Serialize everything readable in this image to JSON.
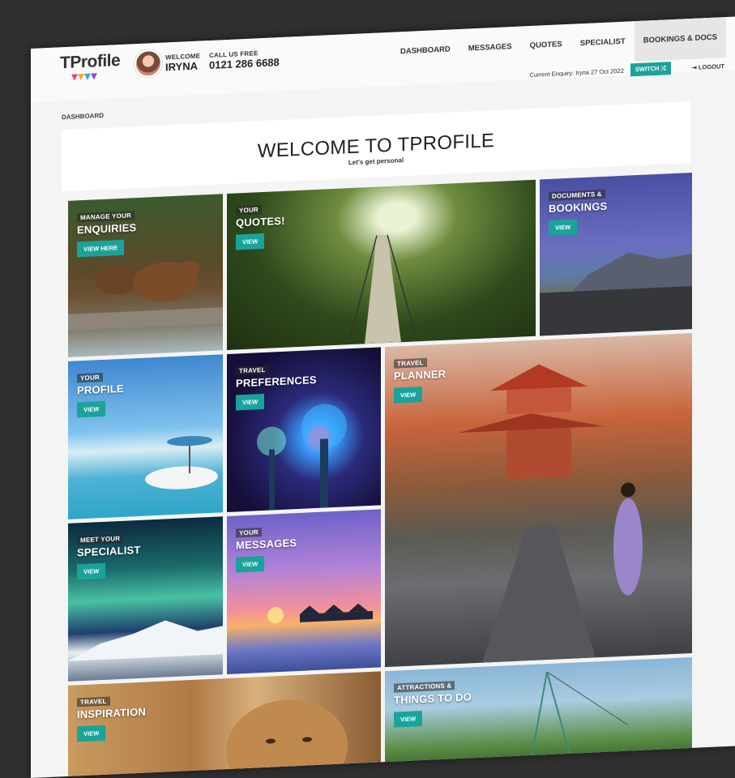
{
  "header": {
    "logo_text": "TProfile",
    "welcome_label": "WELCOME",
    "user_name": "IRYNA",
    "call_label": "CALL US FREE",
    "phone": "0121 286 6688"
  },
  "nav": [
    {
      "label": "DASHBOARD"
    },
    {
      "label": "MESSAGES"
    },
    {
      "label": "QUOTES"
    },
    {
      "label": "SPECIALIST"
    },
    {
      "label": "BOOKINGS & DOCS"
    }
  ],
  "subbar": {
    "enquiry_text": "Current Enquiry: Iryna 27 Oct 2022",
    "switch_label": "SWITCH ⤭",
    "logout_label": "⇥ LOGOUT"
  },
  "breadcrumb": "DASHBOARD",
  "hero": {
    "title": "WELCOME TO TPROFILE",
    "subtitle": "Let's get personal"
  },
  "tiles": {
    "enquiries": {
      "tag": "MANAGE YOUR",
      "title": "ENQUIRIES",
      "button": "VIEW HERE"
    },
    "quotes": {
      "tag": "YOUR",
      "title": "QUOTES!",
      "button": "VIEW"
    },
    "documents": {
      "tag": "DOCUMENTS &",
      "title": "BOOKINGS",
      "button": "VIEW"
    },
    "profile": {
      "tag": "YOUR",
      "title": "PROFILE",
      "button": "VIEW"
    },
    "preferences": {
      "tag": "TRAVEL",
      "title": "PREFERENCES",
      "button": "VIEW"
    },
    "planner": {
      "tag": "TRAVEL",
      "title": "PLANNER",
      "button": "VIEW"
    },
    "specialist": {
      "tag": "MEET YOUR",
      "title": "SPECIALIST",
      "button": "VIEW"
    },
    "messages": {
      "tag": "YOUR",
      "title": "MESSAGES",
      "button": "VIEW"
    },
    "inspiration": {
      "tag": "TRAVEL",
      "title": "INSPIRATION",
      "button": "VIEW"
    },
    "attractions": {
      "tag": "ATTRACTIONS &",
      "title": "THINGS TO DO",
      "button": "VIEW"
    }
  },
  "colors": {
    "accent": "#1aa39b",
    "backdrop": "#303030"
  }
}
